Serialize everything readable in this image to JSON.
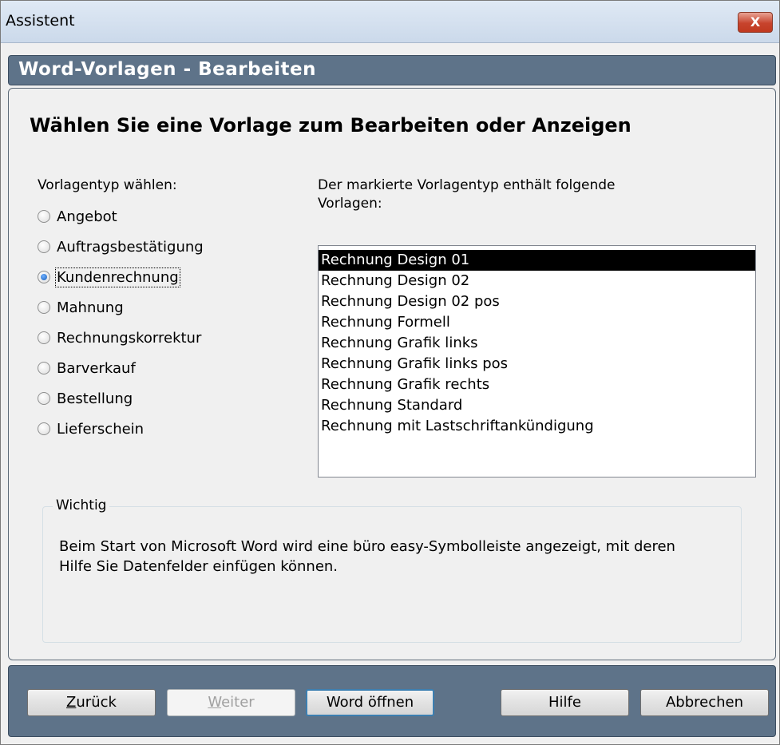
{
  "window": {
    "title": "Assistent",
    "close_label": "X"
  },
  "header": {
    "title": "Word-Vorlagen - Bearbeiten"
  },
  "panel": {
    "heading": "Wählen Sie eine Vorlage zum Bearbeiten oder Anzeigen",
    "type_label": "Vorlagentyp wählen:",
    "list_label_line1": "Der markierte Vorlagentyp enthält folgende",
    "list_label_line2": "Vorlagen:"
  },
  "types": [
    {
      "label": "Angebot",
      "checked": false
    },
    {
      "label": "Auftragsbestätigung",
      "checked": false
    },
    {
      "label": "Kundenrechnung",
      "checked": true
    },
    {
      "label": "Mahnung",
      "checked": false
    },
    {
      "label": "Rechnungskorrektur",
      "checked": false
    },
    {
      "label": "Barverkauf",
      "checked": false
    },
    {
      "label": "Bestellung",
      "checked": false
    },
    {
      "label": "Lieferschein",
      "checked": false
    }
  ],
  "templates": [
    {
      "label": "Rechnung Design 01",
      "selected": true
    },
    {
      "label": "Rechnung Design 02",
      "selected": false
    },
    {
      "label": "Rechnung Design 02 pos",
      "selected": false
    },
    {
      "label": "Rechnung Formell",
      "selected": false
    },
    {
      "label": "Rechnung Grafik links",
      "selected": false
    },
    {
      "label": "Rechnung Grafik links pos",
      "selected": false
    },
    {
      "label": "Rechnung Grafik rechts",
      "selected": false
    },
    {
      "label": "Rechnung Standard",
      "selected": false
    },
    {
      "label": "Rechnung mit Lastschriftankündigung",
      "selected": false
    }
  ],
  "notice": {
    "title": "Wichtig",
    "line1": "Beim Start von Microsoft Word wird eine büro easy-Symbolleiste angezeigt, mit deren",
    "line2": "Hilfe Sie Datenfelder einfügen können."
  },
  "buttons": {
    "back_first": "Z",
    "back_rest": "urück",
    "next_first": "W",
    "next_rest": "eiter",
    "open_word": "Word öffnen",
    "help": "Hilfe",
    "cancel": "Abbrechen"
  },
  "colors": {
    "header_band": "#5e7389",
    "selection": "#000000"
  }
}
